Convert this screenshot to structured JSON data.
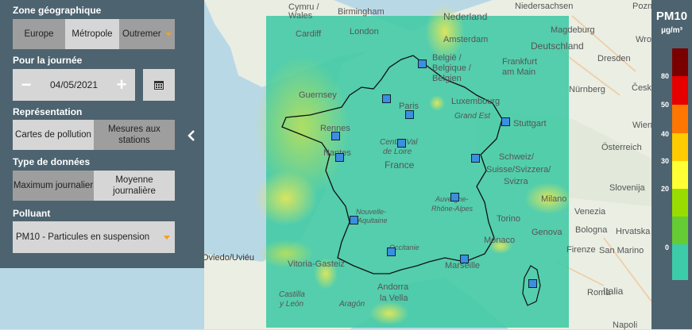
{
  "zone": {
    "title": "Zone géographique",
    "options": [
      "Europe",
      "Métropole",
      "Outremer"
    ],
    "active": 1
  },
  "day": {
    "title": "Pour la journée",
    "minus": "−",
    "date": "04/05/2021",
    "plus": "+"
  },
  "representation": {
    "title": "Représentation",
    "options": [
      "Cartes de pollution",
      "Mesures aux stations"
    ],
    "active": 0
  },
  "data_type": {
    "title": "Type de données",
    "options": [
      "Maximum journalier",
      "Moyenne journalière"
    ],
    "active": 0
  },
  "pollutant": {
    "title": "Polluant",
    "value": "PM10 - Particules en suspension"
  },
  "legend": {
    "title": "PM10",
    "unit": "µg/m³",
    "ticks": [
      "80",
      "50",
      "40",
      "30",
      "20",
      "0"
    ],
    "colors": [
      "#7a0000",
      "#e60000",
      "#ff7700",
      "#ffcc00",
      "#ffff33",
      "#99dd00",
      "#66cc33",
      "#3dccaa"
    ]
  },
  "map_labels": {
    "cymru": "Cymru /",
    "wales": "Wales",
    "birmingham": "Birmingham",
    "nederland": "Nederland",
    "niedersachsen": "Niedersachsen",
    "cardiff": "Cardiff",
    "london": "London",
    "amsterdam": "Amsterdam",
    "magdeburg": "Magdeburg",
    "belgie": "België /",
    "belgique": "Belgique /",
    "belgien": "Belgien",
    "frankfurt": "Frankfurt",
    "am_main": "am Main",
    "deutschland": "Deutschland",
    "dresden": "Dresden",
    "cesko": "Česko",
    "nurnberg": "Nürnberg",
    "guernsey": "Guernsey",
    "paris": "Paris",
    "luxembourg": "Luxembourg",
    "grand_est": "Grand Est",
    "stuttgart": "Stuttgart",
    "rennes": "Rennes",
    "nantes": "Nantes",
    "centre": "Centre-Val",
    "de_loire": "de Loire",
    "france": "France",
    "osterreich": "Österreich",
    "schweiz": "Schweiz/",
    "suisse": "Suisse/Svizzera/",
    "svizra": "Svizra",
    "slovenija": "Slovenija",
    "auvergne": "Auvergne-",
    "rhone_alpes": "Rhône-Alpes",
    "milano": "Milano",
    "torino": "Torino",
    "venezia": "Venezia",
    "nouvelle": "Nouvelle-",
    "aquitaine": "Aquitaine",
    "genova": "Genova",
    "bologna": "Bologna",
    "hrvatska": "Hrvatska",
    "monaco": "Monaco",
    "oviedo": "Oviedo/Uviéu",
    "occitanie": "Occitanie",
    "firenze": "Firenze",
    "san_marino": "San Marino",
    "vitoria": "Vitoria-Gasteiz",
    "marseille": "Marseille",
    "castilla": "Castilla",
    "y_leon": "y León",
    "aragon": "Aragón",
    "andorra": "Andorra",
    "la_vella": "la Vella",
    "italia": "Italia",
    "roma": "Roma",
    "napoli": "Napoli",
    "poznan": "Poznań",
    "wroclaw": "Wrocław",
    "wien": "Wien"
  }
}
